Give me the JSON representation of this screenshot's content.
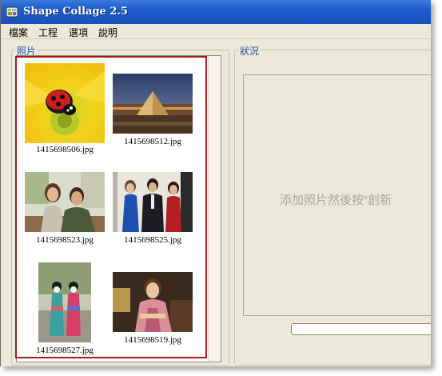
{
  "window": {
    "title": "Shape Collage 2.5"
  },
  "menu": {
    "items": [
      "檔案",
      "工程",
      "選項",
      "說明"
    ]
  },
  "photos_panel": {
    "legend": "照片",
    "photos": [
      {
        "filename": "1415698506.jpg",
        "subject": "ladybug-on-flower"
      },
      {
        "filename": "1415698512.jpg",
        "subject": "louvre-pyramid-night"
      },
      {
        "filename": "1415698523.jpg",
        "subject": "couple-portrait"
      },
      {
        "filename": "1415698525.jpg",
        "subject": "group-formal"
      },
      {
        "filename": "1415698527.jpg",
        "subject": "geisha-walking"
      },
      {
        "filename": "1415698519.jpg",
        "subject": "woman-kimono"
      }
    ]
  },
  "status_panel": {
    "legend": "狀況",
    "hint": "添加照片然後按“創新"
  },
  "colors": {
    "highlight_border": "#a31c1c",
    "title_gradient": "#1f5fd0",
    "legend": "#2a4fa8"
  }
}
